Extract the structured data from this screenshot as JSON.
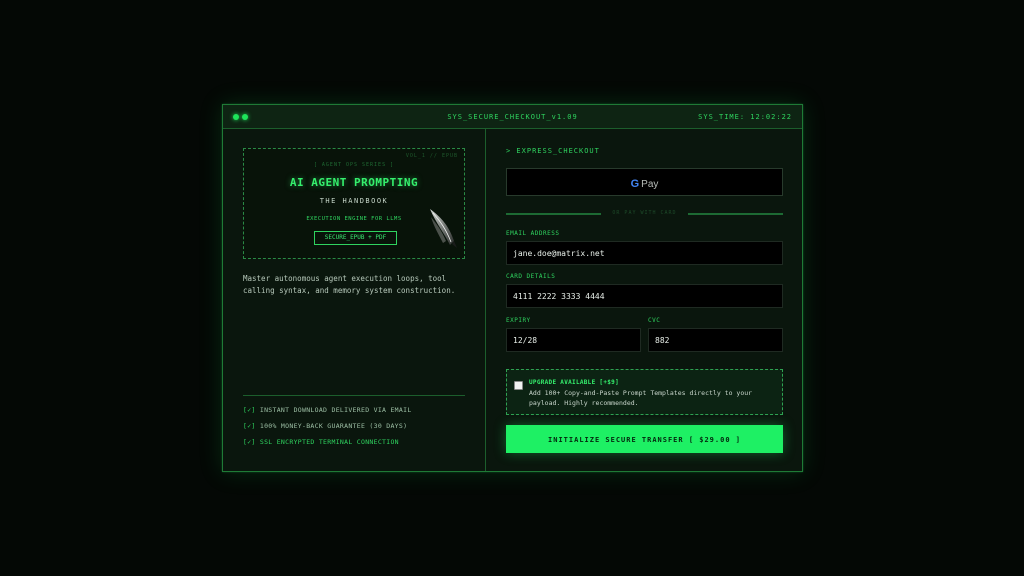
{
  "window": {
    "title": "SYS_SECURE_CHECKOUT_v1.09",
    "sys_time": "SYS_TIME: 12:02:22"
  },
  "product": {
    "cover": {
      "tag": "VOL_1 // EPUB",
      "brand": "[ AGENT OPS SERIES ]",
      "title": "AI AGENT PROMPTING",
      "subtitle": "THE HANDBOOK",
      "engine": "EXECUTION ENGINE FOR LLMS",
      "format": "SECURE_EPUB + PDF",
      "art_icon": "feather-quill-icon"
    },
    "description": "Master autonomous agent execution loops, tool calling syntax, and memory system construction.",
    "features": [
      {
        "check": "[✓]",
        "text": "INSTANT DOWNLOAD DELIVERED VIA EMAIL"
      },
      {
        "check": "[✓]",
        "text": "100% MONEY-BACK GUARANTEE (30 DAYS)"
      },
      {
        "check": "[✓]",
        "text": "SSL ENCRYPTED TERMINAL CONNECTION"
      }
    ]
  },
  "checkout": {
    "express_label": "> EXPRESS_CHECKOUT",
    "gpay": {
      "g": "G",
      "label": "Pay"
    },
    "divider_text": "OR PAY WITH CARD",
    "email": {
      "label": "EMAIL ADDRESS",
      "value": "jane.doe@matrix.net"
    },
    "card": {
      "label": "CARD DETAILS",
      "value": "4111 2222 3333 4444"
    },
    "expiry": {
      "label": "EXPIRY",
      "value": "12/28"
    },
    "cvc": {
      "label": "CVC",
      "value": "882"
    },
    "upsell": {
      "heading": "UPGRADE AVAILABLE [+$9]",
      "body": "Add 100+ Copy-and-Paste Prompt Templates directly to your payload. Highly recommended.",
      "checked": false
    },
    "submit_label": "INITIALIZE SECURE TRANSFER [ $29.00 ]"
  },
  "colors": {
    "accent": "#1ef064",
    "window_bg": "#0a160d",
    "border": "#1f7a36"
  }
}
